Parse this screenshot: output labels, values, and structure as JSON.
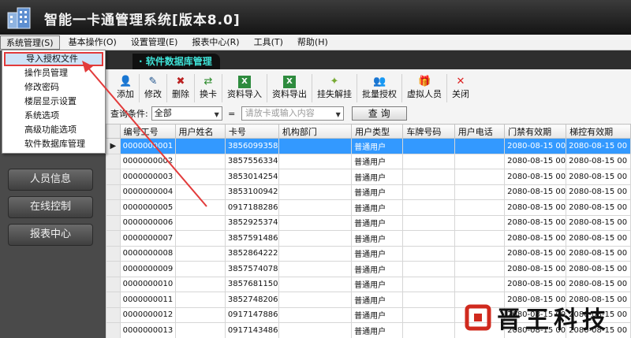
{
  "app": {
    "title": "智能一卡通管理系统[版本8.0]"
  },
  "menubar": {
    "items": [
      "系统管理(S)",
      "基本操作(O)",
      "设置管理(E)",
      "报表中心(R)",
      "工具(T)",
      "帮助(H)"
    ]
  },
  "dropdown": {
    "items": [
      "导入授权文件",
      "操作员管理",
      "修改密码",
      "楼层显示设置",
      "系统选项",
      "高级功能选项",
      "软件数据库管理"
    ]
  },
  "tab": {
    "label": "· 软件数据库管理"
  },
  "sidebar": {
    "buttons": [
      "人员信息",
      "在线控制",
      "报表中心"
    ]
  },
  "toolbar": {
    "buttons": [
      {
        "label": "添加",
        "icon": "add-user-icon"
      },
      {
        "label": "修改",
        "icon": "edit-user-icon"
      },
      {
        "label": "删除",
        "icon": "delete-user-icon"
      },
      {
        "label": "换卡",
        "icon": "swap-card-icon"
      },
      {
        "label": "资料导入",
        "icon": "excel-import-icon"
      },
      {
        "label": "资料导出",
        "icon": "excel-export-icon"
      },
      {
        "label": "挂失解挂",
        "icon": "loss-report-icon"
      },
      {
        "label": "批量授权",
        "icon": "batch-authorize-icon"
      },
      {
        "label": "虚拟人员",
        "icon": "virtual-person-icon"
      },
      {
        "label": "关闭",
        "icon": "close-icon"
      }
    ]
  },
  "query": {
    "label": "查询条件:",
    "condition": "全部",
    "operator": "=",
    "placeholder": "请放卡或输入内容",
    "button": "查 询"
  },
  "table": {
    "columns": [
      "编号工号",
      "用户姓名",
      "卡号",
      "机构部门",
      "用户类型",
      "车牌号码",
      "用户电话",
      "门禁有效期",
      "梯控有效期"
    ],
    "rows": [
      [
        "0000000001",
        "",
        "3856099358",
        "",
        "普通用户",
        "",
        "",
        "2080-08-15 00",
        "2080-08-15 00"
      ],
      [
        "0000000002",
        "",
        "3857556334",
        "",
        "普通用户",
        "",
        "",
        "2080-08-15 00",
        "2080-08-15 00"
      ],
      [
        "0000000003",
        "",
        "3853014254",
        "",
        "普通用户",
        "",
        "",
        "2080-08-15 00",
        "2080-08-15 00"
      ],
      [
        "0000000004",
        "",
        "3853100942",
        "",
        "普通用户",
        "",
        "",
        "2080-08-15 00",
        "2080-08-15 00"
      ],
      [
        "0000000005",
        "",
        "0917188286",
        "",
        "普通用户",
        "",
        "",
        "2080-08-15 00",
        "2080-08-15 00"
      ],
      [
        "0000000006",
        "",
        "3852925374",
        "",
        "普通用户",
        "",
        "",
        "2080-08-15 00",
        "2080-08-15 00"
      ],
      [
        "0000000007",
        "",
        "3857591486",
        "",
        "普通用户",
        "",
        "",
        "2080-08-15 00",
        "2080-08-15 00"
      ],
      [
        "0000000008",
        "",
        "3852864222",
        "",
        "普通用户",
        "",
        "",
        "2080-08-15 00",
        "2080-08-15 00"
      ],
      [
        "0000000009",
        "",
        "3857574078",
        "",
        "普通用户",
        "",
        "",
        "2080-08-15 00",
        "2080-08-15 00"
      ],
      [
        "0000000010",
        "",
        "3857681150",
        "",
        "普通用户",
        "",
        "",
        "2080-08-15 00",
        "2080-08-15 00"
      ],
      [
        "0000000011",
        "",
        "3852748206",
        "",
        "普通用户",
        "",
        "",
        "2080-08-15 00",
        "2080-08-15 00"
      ],
      [
        "0000000012",
        "",
        "0917147886",
        "",
        "普通用户",
        "",
        "",
        "2080-08-15 00",
        "2080-08-15 00"
      ],
      [
        "0000000013",
        "",
        "0917143486",
        "",
        "普通用户",
        "",
        "",
        "2080-08-15 00",
        "2080-08-15 00"
      ]
    ],
    "selected_row": 0
  },
  "watermark": {
    "text": "晋王科技"
  },
  "colors": {
    "selection": "#3399ff",
    "tab_text": "#3fe3d8",
    "annotation": "#e23b3b"
  }
}
